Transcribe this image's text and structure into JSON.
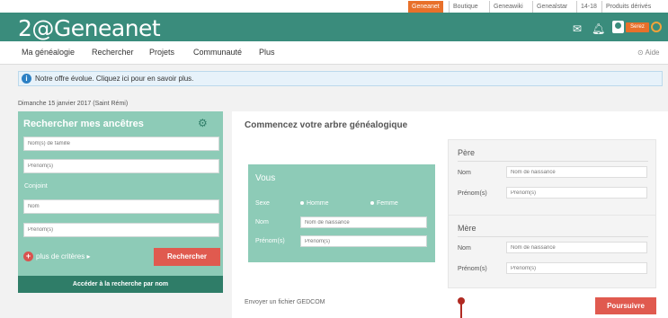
{
  "top_links": [
    {
      "label": "Geneanet",
      "active": true
    },
    {
      "label": "Boutique",
      "active": false
    },
    {
      "label": "Geneawiki",
      "active": false
    },
    {
      "label": "Genealstar",
      "active": false
    },
    {
      "label": "14-18",
      "active": false
    },
    {
      "label": "Produits dérivés",
      "active": false
    }
  ],
  "header": {
    "logo": "2@Geneanet",
    "badge": "Serez"
  },
  "nav": {
    "items": [
      "Ma généalogie",
      "Rechercher",
      "Projets",
      "Communauté",
      "Plus"
    ],
    "help": "Aide"
  },
  "banner": {
    "text": "Notre offre évolue. Cliquez ici pour en savoir plus."
  },
  "date_line": "Dimanche 15 janvier 2017 (Saint Rémi)",
  "search_panel": {
    "title": "Rechercher mes ancêtres",
    "family_name_placeholder": "Nom(s) de famille",
    "first_name_placeholder": "Prénom(s)",
    "spouse_label": "Conjoint",
    "spouse_name_placeholder": "Nom",
    "spouse_first_name_placeholder": "Prénom(s)",
    "more_criteria": "plus de critères ▸",
    "search_button": "Rechercher",
    "footer_link": "Accéder à la recherche par nom"
  },
  "tree": {
    "title": "Commencez votre arbre généalogique",
    "vous": {
      "title": "Vous",
      "sex_label": "Sexe",
      "male": "Homme",
      "female": "Femme",
      "name_label": "Nom",
      "name_placeholder": "Nom de naissance",
      "first_label": "Prénom(s)",
      "first_placeholder": "Prénom(s)"
    },
    "father": {
      "title": "Père",
      "name_label": "Nom",
      "name_placeholder": "Nom de naissance",
      "first_label": "Prénom(s)",
      "first_placeholder": "Prénom(s)"
    },
    "mother": {
      "title": "Mère",
      "name_label": "Nom",
      "name_placeholder": "Nom de naissance",
      "first_label": "Prénom(s)",
      "first_placeholder": "Prénom(s)"
    },
    "gedcom_link": "Envoyer un fichier GEDCOM",
    "continue_button": "Poursuivre"
  },
  "colors": {
    "brand_green": "#3a8c7c",
    "panel_green": "#8dcbb7",
    "accent_orange": "#e8702a",
    "action_red": "#e05a4f"
  }
}
